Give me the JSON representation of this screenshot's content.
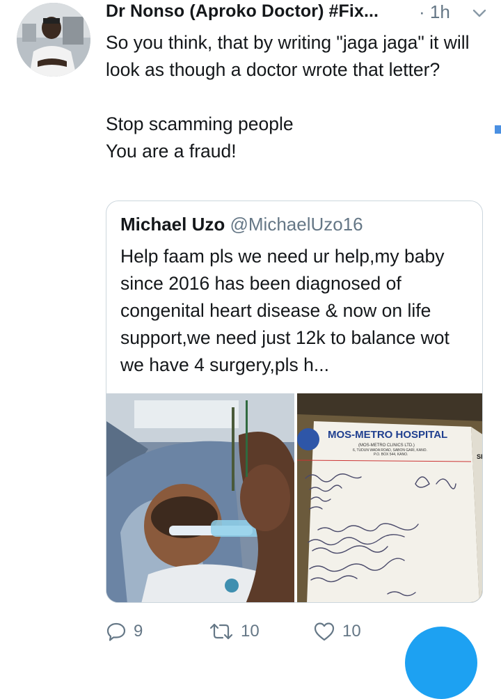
{
  "tweet": {
    "author": "Dr Nonso (Aproko Doctor) #Fix...",
    "time": "· 1h",
    "text": "So you think, that by writing \"jaga jaga\" it will look as though a doctor wrote that letter?\n\nStop scamming people\nYou are a fraud!"
  },
  "quote": {
    "name": "Michael Uzo",
    "handle": "@MichaelUzo16",
    "text": "Help faam pls we need ur help,my baby since 2016 has been diagnosed of congenital heart disease & now on life support,we need just 12k to balance wot we have 4 surgery,pls h...",
    "letter": {
      "hospital": "MOS-METRO HOSPITAL",
      "subtitle": "(MOS-METRO CLINICS LTD.)",
      "address1": "6, TUDUN WADA ROAD, SABON GARI, KANO.",
      "address2": "P.O. BOX 544, KANO."
    }
  },
  "actions": {
    "replies": "9",
    "retweets": "10",
    "likes": "10"
  },
  "colors": {
    "text": "#14171a",
    "secondary": "#657786",
    "accent": "#1da1f2",
    "border": "#ccd6dd"
  },
  "icons": {
    "reply": "reply-icon",
    "retweet": "retweet-icon",
    "like": "heart-icon",
    "caret": "chevron-down-icon",
    "compose": "compose-fab"
  }
}
